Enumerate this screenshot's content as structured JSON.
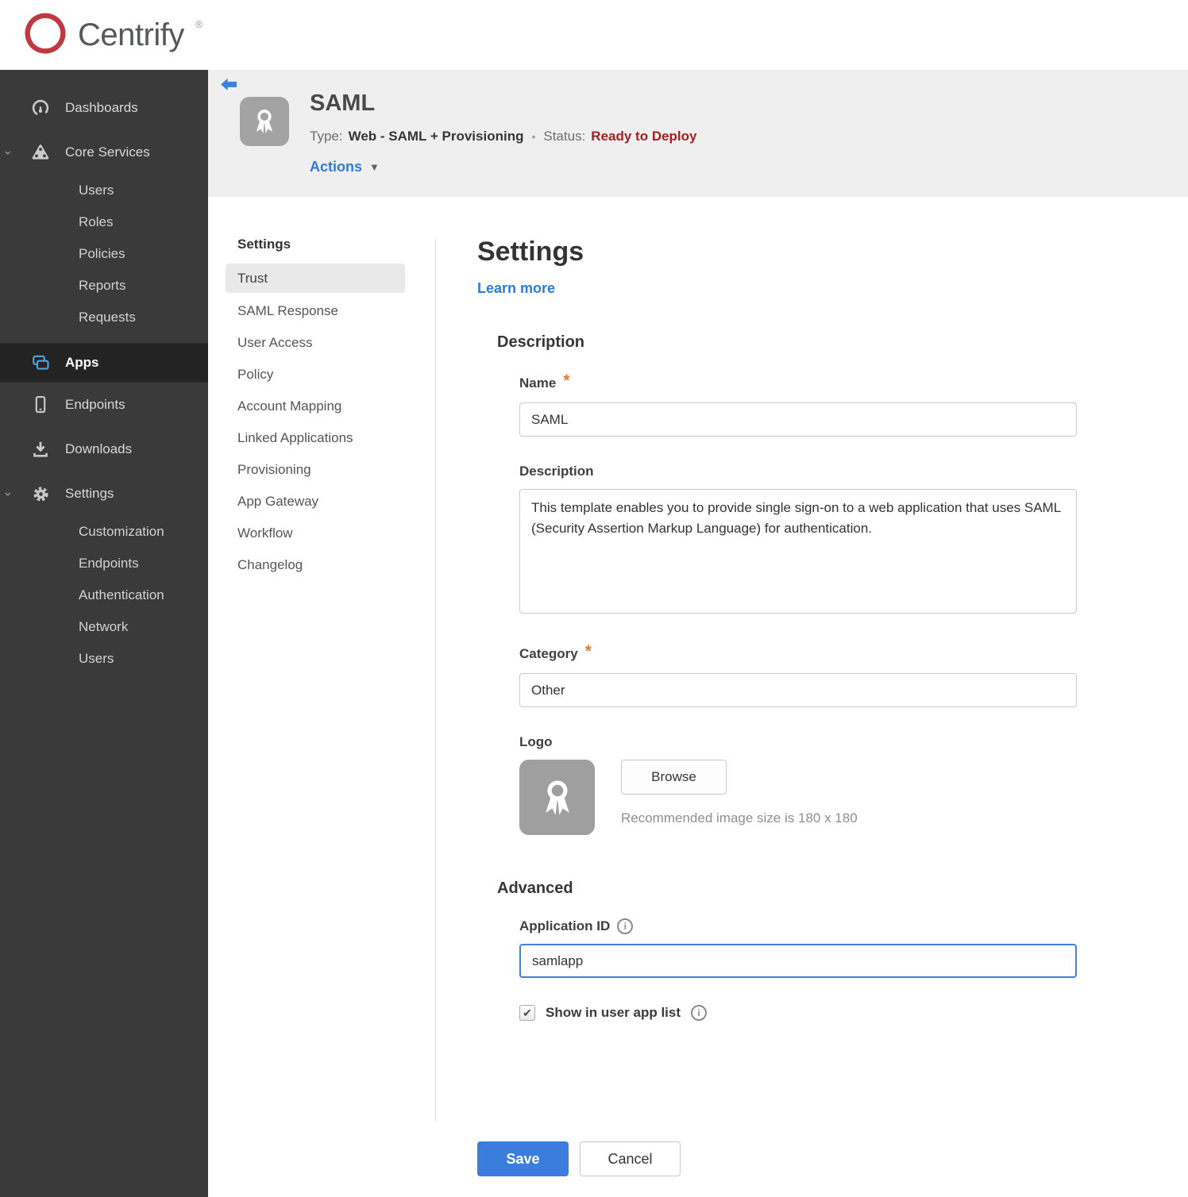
{
  "brand": {
    "name": "Centrify",
    "trademark": "®"
  },
  "sidebar": {
    "items": [
      {
        "label": "Dashboards"
      },
      {
        "label": "Core Services",
        "expanded": true
      },
      {
        "label": "Users"
      },
      {
        "label": "Roles"
      },
      {
        "label": "Policies"
      },
      {
        "label": "Reports"
      },
      {
        "label": "Requests"
      },
      {
        "label": "Apps",
        "active": true
      },
      {
        "label": "Endpoints"
      },
      {
        "label": "Downloads"
      },
      {
        "label": "Settings",
        "expanded": true
      },
      {
        "label": "Customization"
      },
      {
        "label": "Endpoints"
      },
      {
        "label": "Authentication"
      },
      {
        "label": "Network"
      },
      {
        "label": "Users"
      }
    ]
  },
  "app_header": {
    "title": "SAML",
    "type_label": "Type:",
    "type_value": "Web - SAML + Provisioning",
    "separator": "•",
    "status_label": "Status:",
    "status_value": "Ready to Deploy",
    "actions_label": "Actions"
  },
  "subnav": {
    "header": "Settings",
    "items": [
      {
        "label": "Trust",
        "selected": true
      },
      {
        "label": "SAML Response"
      },
      {
        "label": "User Access"
      },
      {
        "label": "Policy"
      },
      {
        "label": "Account Mapping"
      },
      {
        "label": "Linked Applications"
      },
      {
        "label": "Provisioning"
      },
      {
        "label": "App Gateway"
      },
      {
        "label": "Workflow"
      },
      {
        "label": "Changelog"
      }
    ]
  },
  "form": {
    "heading": "Settings",
    "learn_more": "Learn more",
    "description_section": {
      "title": "Description",
      "name_label": "Name",
      "required_marker": "*",
      "name_value": "SAML",
      "description_label": "Description",
      "description_value": "This template enables you to provide single sign-on to a web application that uses SAML (Security Assertion Markup Language) for authentication.",
      "category_label": "Category",
      "category_value": "Other",
      "logo_label": "Logo",
      "browse_label": "Browse",
      "logo_hint": "Recommended image size is 180 x 180"
    },
    "advanced_section": {
      "title": "Advanced",
      "application_id_label": "Application ID",
      "application_id_value": "samlapp",
      "show_in_user_app_list_label": "Show in user app list",
      "show_in_user_app_list_checked": true
    },
    "actions": {
      "save_label": "Save",
      "cancel_label": "Cancel"
    }
  },
  "icons": {
    "info_glyph": "i",
    "caret_down": "▼",
    "check_glyph": "✔",
    "chevron_down": "⌄"
  },
  "colors": {
    "accent_blue": "#3b7ddd",
    "link_blue": "#2e7cd6",
    "status_red": "#a32020",
    "required_orange": "#e87a2e",
    "apps_icon_blue": "#4aa3df",
    "sidebar_bg": "#3a3a3a",
    "header_strip_bg": "#efefef"
  }
}
